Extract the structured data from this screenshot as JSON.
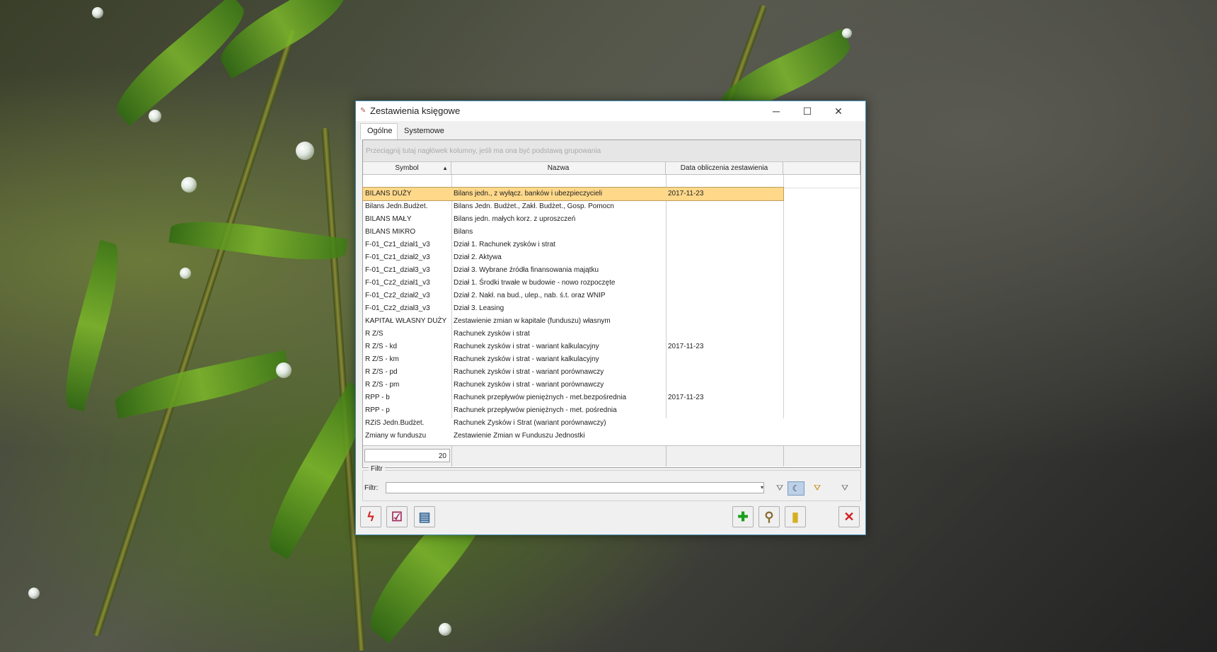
{
  "window": {
    "title": "Zestawienia księgowe",
    "minimize": "─",
    "maximize": "☐",
    "close": "✕"
  },
  "tabs": [
    {
      "label": "Ogólne",
      "active": true
    },
    {
      "label": "Systemowe",
      "active": false
    }
  ],
  "grid": {
    "group_hint": "Przeciągnij tutaj nagłówek kolumny, jeśli ma ona być podstawą grupowania",
    "columns": [
      "Symbol",
      "Nazwa",
      "Data obliczenia zestawienia"
    ],
    "sort_indicator": "▲",
    "rows": [
      {
        "symbol": "BILANS DUŻY",
        "nazwa": "Bilans jedn., z wyłącz. banków i ubezpieczycieli",
        "data": "2017-11-23"
      },
      {
        "symbol": "Bilans Jedn.Budżet.",
        "nazwa": "Bilans Jedn. Budżet.,  Zakł. Budżet., Gosp. Pomocn",
        "data": ""
      },
      {
        "symbol": "BILANS MAŁY",
        "nazwa": "Bilans jedn. małych korz. z uproszczeń",
        "data": ""
      },
      {
        "symbol": "BILANS MIKRO",
        "nazwa": "Bilans",
        "data": ""
      },
      {
        "symbol": "F-01_Cz1_dział1_v3",
        "nazwa": "Dział 1. Rachunek zysków i strat",
        "data": ""
      },
      {
        "symbol": "F-01_Cz1_dział2_v3",
        "nazwa": "Dział 2. Aktywa",
        "data": ""
      },
      {
        "symbol": "F-01_Cz1_dział3_v3",
        "nazwa": "Dział 3. Wybrane źródła finansowania majątku",
        "data": ""
      },
      {
        "symbol": "F-01_Cz2_dział1_v3",
        "nazwa": "Dział 1. Środki trwałe w budowie - nowo rozpoczęte",
        "data": ""
      },
      {
        "symbol": "F-01_Cz2_dział2_v3",
        "nazwa": "Dział 2. Nakł. na bud., ulep., nab. ś.t. oraz WNIP",
        "data": ""
      },
      {
        "symbol": "F-01_Cz2_dział3_v3",
        "nazwa": "Dział 3. Leasing",
        "data": ""
      },
      {
        "symbol": "KAPITAŁ WŁASNY DUŻY",
        "nazwa": "Zestawienie zmian w kapitale (funduszu) własnym",
        "data": ""
      },
      {
        "symbol": "R Z/S",
        "nazwa": "Rachunek zysków i strat",
        "data": ""
      },
      {
        "symbol": "R Z/S - kd",
        "nazwa": "Rachunek zysków i strat - wariant kalkulacyjny",
        "data": "2017-11-23"
      },
      {
        "symbol": "R Z/S - km",
        "nazwa": "Rachunek zysków i strat - wariant kalkulacyjny",
        "data": ""
      },
      {
        "symbol": "R Z/S - pd",
        "nazwa": "Rachunek zysków i strat - wariant porównawczy",
        "data": ""
      },
      {
        "symbol": "R Z/S - pm",
        "nazwa": "Rachunek zysków i strat - wariant porównawczy",
        "data": ""
      },
      {
        "symbol": "RPP - b",
        "nazwa": "Rachunek przepływów pieniężnych - met.bezpośrednia",
        "data": "2017-11-23"
      },
      {
        "symbol": "RPP - p",
        "nazwa": "Rachunek przepływów pieniężnych - met. pośrednia",
        "data": ""
      },
      {
        "symbol": "RZiS Jedn.Budżet.",
        "nazwa": "Rachunek Zysków i Strat (wariant porównawczy)",
        "data": ""
      },
      {
        "symbol": "Zmiany w funduszu",
        "nazwa": "Zestawienie Zmian w Funduszu Jednostki",
        "data": ""
      }
    ],
    "selected_row": 0,
    "count": "20"
  },
  "filter": {
    "legend": "Filtr",
    "label": "Filtr:",
    "value": "",
    "dropdown_icon": "▾",
    "buttons": [
      {
        "name": "funnel-icon",
        "glyph": "⛛"
      },
      {
        "name": "moon-filter-icon",
        "glyph": "☾"
      },
      {
        "name": "funnel-settings-icon",
        "glyph": "⛛"
      },
      {
        "name": "funnel-clear-icon",
        "glyph": "⛛"
      }
    ]
  },
  "toolbar": {
    "left_buttons": [
      {
        "name": "calculate-button",
        "icon": "lightning-icon",
        "glyph": "ϟ",
        "color": "#d42020"
      },
      {
        "name": "checklist-button",
        "icon": "checklist-icon",
        "glyph": "☑",
        "color": "#a03060"
      },
      {
        "name": "books-button",
        "icon": "books-icon",
        "glyph": "▤",
        "color": "#3a6a9a"
      }
    ],
    "right_buttons": [
      {
        "name": "add-button",
        "icon": "plus-icon",
        "glyph": "✚",
        "color": "#1aa01a"
      },
      {
        "name": "edit-button",
        "icon": "magnifier-icon",
        "glyph": "⚲",
        "color": "#8a6a30"
      },
      {
        "name": "delete-button",
        "icon": "trash-icon",
        "glyph": "▮",
        "color": "#d4b020"
      }
    ],
    "close_button": {
      "name": "close-button",
      "icon": "close-x-icon",
      "glyph": "✕",
      "color": "#d42020"
    }
  }
}
